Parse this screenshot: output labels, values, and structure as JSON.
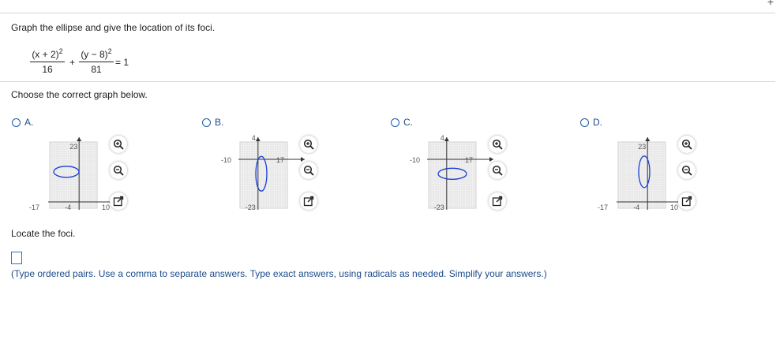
{
  "question": {
    "prompt": "Graph the ellipse and give the location of its foci.",
    "equation": {
      "term1_numerator": "(x + 2)",
      "term1_exponent": "2",
      "term1_denominator": "16",
      "plus": "+",
      "term2_numerator": "(y − 8)",
      "term2_exponent": "2",
      "term2_denominator": "81",
      "rhs": "= 1"
    }
  },
  "choose_label": "Choose the correct graph below.",
  "options": [
    {
      "letter": "A.",
      "tick_top": "23",
      "tick_left": "-17",
      "tick_mid": "-4",
      "tick_right": "10",
      "tick_bottom": ""
    },
    {
      "letter": "B.",
      "tick_top": "4",
      "tick_left": "-10",
      "tick_mid": "",
      "tick_right": "17",
      "tick_bottom": "-23"
    },
    {
      "letter": "C.",
      "tick_top": "4",
      "tick_left": "-10",
      "tick_mid": "",
      "tick_right": "17",
      "tick_bottom": "-23"
    },
    {
      "letter": "D.",
      "tick_top": "23",
      "tick_left": "-17",
      "tick_mid": "-4",
      "tick_right": "10",
      "tick_bottom": ""
    }
  ],
  "foci": {
    "label": "Locate the foci.",
    "value": "",
    "hint": "(Type ordered pairs. Use a comma to separate answers.  Type exact answers, using radicals as needed. Simplify your answers.)"
  },
  "colors": {
    "accent": "#1c5aa6",
    "ellipse": "#1a3fd0",
    "grid": "#d9d9d9",
    "rule": "#d6d6d6"
  }
}
